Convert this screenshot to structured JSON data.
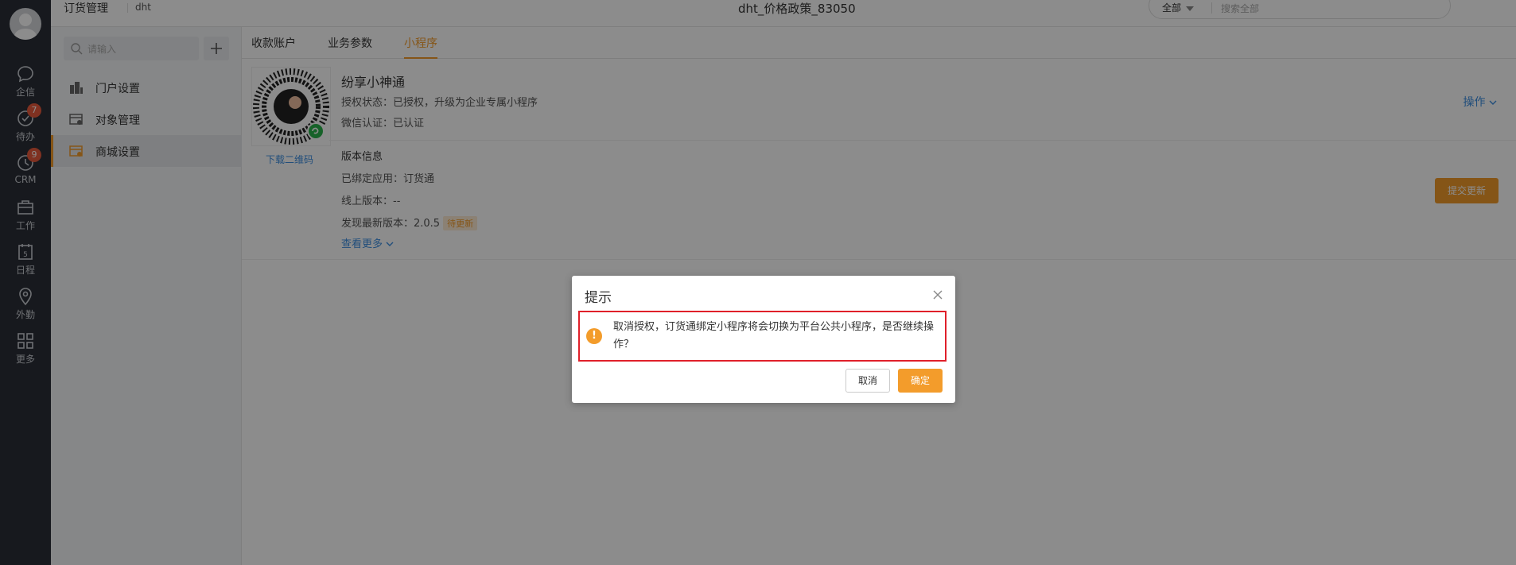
{
  "rail": {
    "items": [
      {
        "label": "企信",
        "icon": "chat-icon"
      },
      {
        "label": "待办",
        "icon": "check-circle-icon",
        "badge": "7"
      },
      {
        "label": "CRM",
        "icon": "clock-icon",
        "badge": "9"
      },
      {
        "label": "工作",
        "icon": "briefcase-icon"
      },
      {
        "label": "日程",
        "icon": "calendar-icon",
        "day": "5"
      },
      {
        "label": "外勤",
        "icon": "location-icon"
      },
      {
        "label": "更多",
        "icon": "grid-icon"
      }
    ]
  },
  "header": {
    "app_title": "订货管理",
    "app_sub": "dht",
    "page_title": "dht_价格政策_83050",
    "search_scope": "全部",
    "search_placeholder": "搜索全部"
  },
  "sidebar": {
    "search_placeholder": "请输入",
    "items": [
      {
        "label": "门户设置",
        "icon": "building-icon"
      },
      {
        "label": "对象管理",
        "icon": "object-settings-icon"
      },
      {
        "label": "商城设置",
        "icon": "mall-settings-icon",
        "active": true
      }
    ]
  },
  "main": {
    "tabs": [
      {
        "label": "收款账户"
      },
      {
        "label": "业务参数"
      },
      {
        "label": "小程序",
        "active": true
      }
    ],
    "qr_download": "下载二维码",
    "miniprogram": {
      "name": "纷享小神通",
      "auth_status": "授权状态：已授权，升级为企业专属小程序",
      "wechat_cert": "微信认证：已认证",
      "operations": "操作"
    },
    "version": {
      "title": "版本信息",
      "bound_app": "已绑定应用：订货通",
      "online_version": "线上版本：--",
      "latest_version": "发现最新版本：2.0.5",
      "pending_tag": "待更新",
      "more": "查看更多",
      "submit": "提交更新"
    }
  },
  "dialog": {
    "title": "提示",
    "message": "取消授权，订货通绑定小程序将会切换为平台公共小程序，是否继续操作？",
    "cancel": "取消",
    "confirm": "确定"
  },
  "colors": {
    "accent": "#f39c2b",
    "link": "#3c8ee0",
    "rail_bg": "#2b2f38",
    "badge": "#e85a3c",
    "highlight_border": "#e0202a"
  }
}
